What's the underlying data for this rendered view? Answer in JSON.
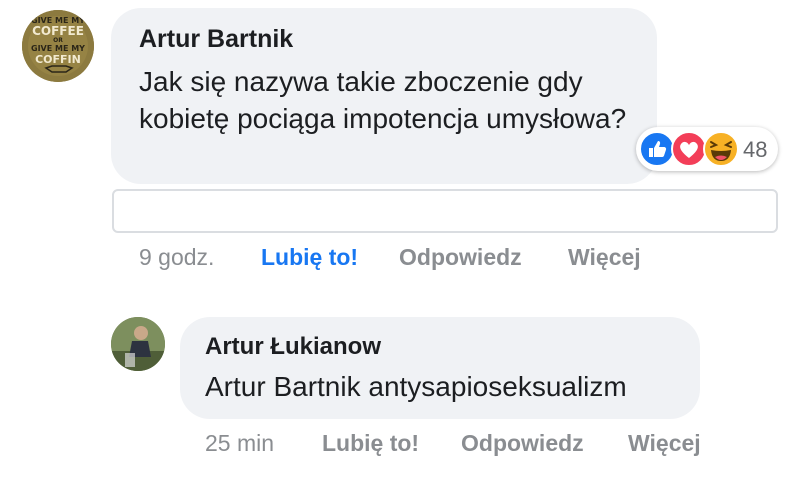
{
  "comments": [
    {
      "author": "Artur Bartnik",
      "text": "Jak się nazywa takie zboczenie gdy kobietę pociąga impotencja umysłowa?",
      "avatar_text": [
        "GIVE ME MY",
        "COFFEE",
        "OR",
        "GIVE ME MY",
        "COFFIN"
      ],
      "reactions": {
        "icons": [
          "like-icon",
          "love-icon",
          "haha-icon"
        ],
        "count": "48"
      },
      "time": "9 godz.",
      "actions": {
        "like": "Lubię to!",
        "reply": "Odpowiedz",
        "more": "Więcej"
      }
    },
    {
      "author": "Artur Łukianow",
      "text": "Artur Bartnik antysapioseksualizm",
      "time": "25 min",
      "actions": {
        "like": "Lubię to!",
        "reply": "Odpowiedz",
        "more": "Więcej"
      }
    }
  ],
  "colors": {
    "bubble": "#f0f2f5",
    "accent": "#1877f2",
    "muted": "#8a8d91",
    "like": "#1877f2",
    "love": "#f33e58",
    "haha": "#f7b125"
  }
}
